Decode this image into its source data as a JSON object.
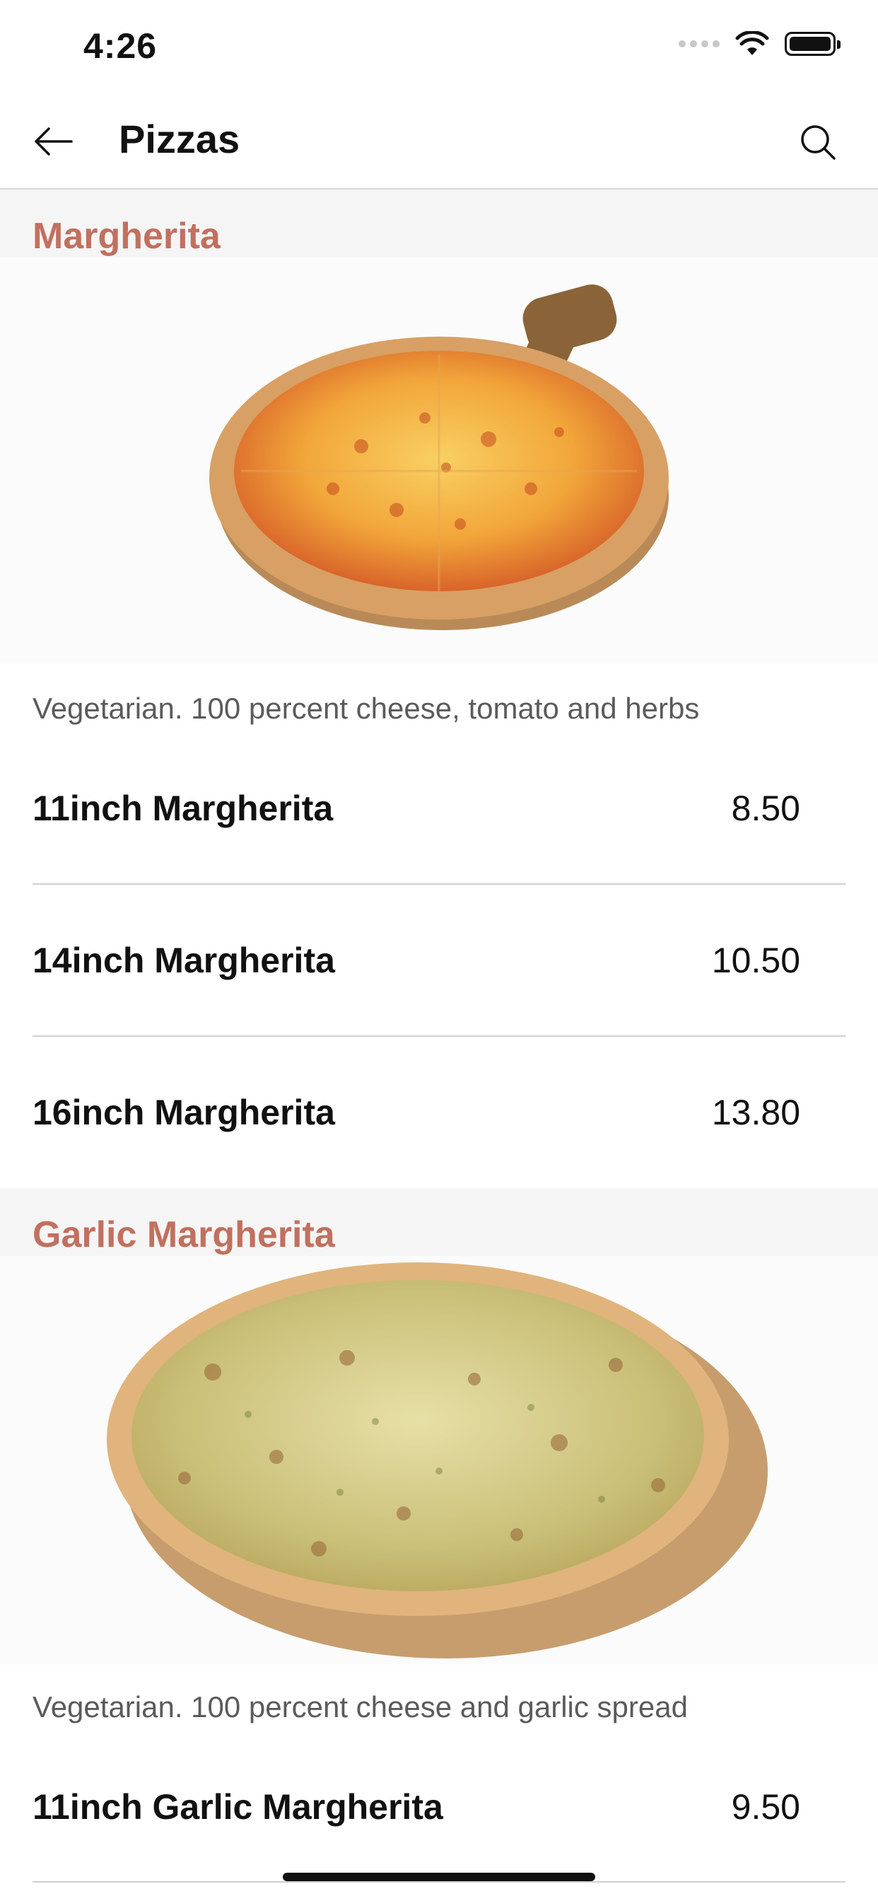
{
  "status_bar": {
    "time": "4:26"
  },
  "nav": {
    "title": "Pizzas",
    "back_icon": "arrow-left-icon",
    "search_icon": "search-icon"
  },
  "sections": [
    {
      "title": "Margherita",
      "description": "Vegetarian. 100 percent cheese, tomato and herbs",
      "items": [
        {
          "name": "11inch Margherita",
          "price": "8.50"
        },
        {
          "name": "14inch Margherita",
          "price": "10.50"
        },
        {
          "name": "16inch Margherita",
          "price": "13.80"
        }
      ]
    },
    {
      "title": "Garlic Margherita",
      "description": "Vegetarian. 100 percent cheese and garlic spread",
      "items": [
        {
          "name": "11inch Garlic Margherita",
          "price": "9.50"
        }
      ]
    }
  ],
  "colors": {
    "section_title": "#c1705f",
    "section_bg": "#f5f5f5"
  }
}
